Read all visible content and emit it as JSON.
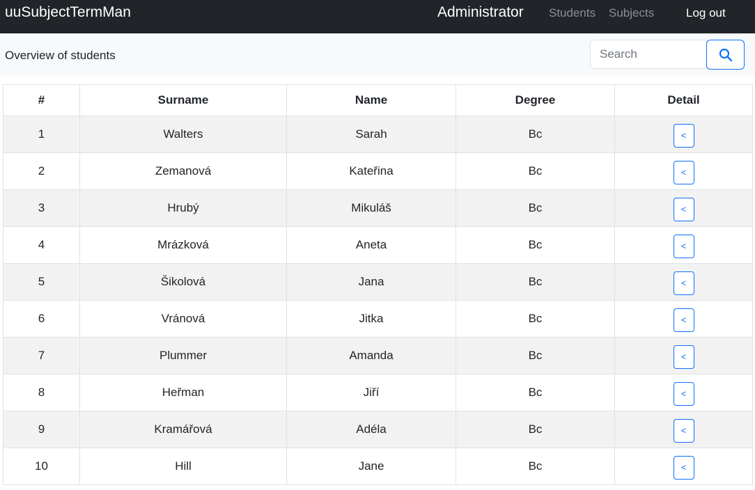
{
  "navbar": {
    "brand": "uuSubjectTermMan",
    "role": "Administrator",
    "links": {
      "students": "Students",
      "subjects": "Subjects"
    },
    "logout": "Log out"
  },
  "subbar": {
    "title": "Overview of students",
    "search": {
      "placeholder": "Search",
      "button_icon": "search-icon"
    }
  },
  "table": {
    "headers": {
      "num": "#",
      "surname": "Surname",
      "name": "Name",
      "degree": "Degree",
      "detail": "Detail"
    },
    "detail_icon": "chevron-left-icon",
    "rows": [
      {
        "num": "1",
        "surname": "Walters",
        "name": "Sarah",
        "degree": "Bc",
        "detail": "<"
      },
      {
        "num": "2",
        "surname": "Zemanová",
        "name": "Kateřina",
        "degree": "Bc",
        "detail": "<"
      },
      {
        "num": "3",
        "surname": "Hrubý",
        "name": "Mikuláš",
        "degree": "Bc",
        "detail": "<"
      },
      {
        "num": "4",
        "surname": "Mrázková",
        "name": "Aneta",
        "degree": "Bc",
        "detail": "<"
      },
      {
        "num": "5",
        "surname": "Šikolová",
        "name": "Jana",
        "degree": "Bc",
        "detail": "<"
      },
      {
        "num": "6",
        "surname": "Vránová",
        "name": "Jitka",
        "degree": "Bc",
        "detail": "<"
      },
      {
        "num": "7",
        "surname": "Plummer",
        "name": "Amanda",
        "degree": "Bc",
        "detail": "<"
      },
      {
        "num": "8",
        "surname": "Heřman",
        "name": "Jiří",
        "degree": "Bc",
        "detail": "<"
      },
      {
        "num": "9",
        "surname": "Kramářová",
        "name": "Adéla",
        "degree": "Bc",
        "detail": "<"
      },
      {
        "num": "10",
        "surname": "Hill",
        "name": "Jane",
        "degree": "Bc",
        "detail": "<"
      }
    ]
  },
  "colors": {
    "navbar_bg": "#212529",
    "subbar_bg": "#f8f9fa",
    "accent": "#0d6efd",
    "striped_row": "#f2f2f2"
  }
}
